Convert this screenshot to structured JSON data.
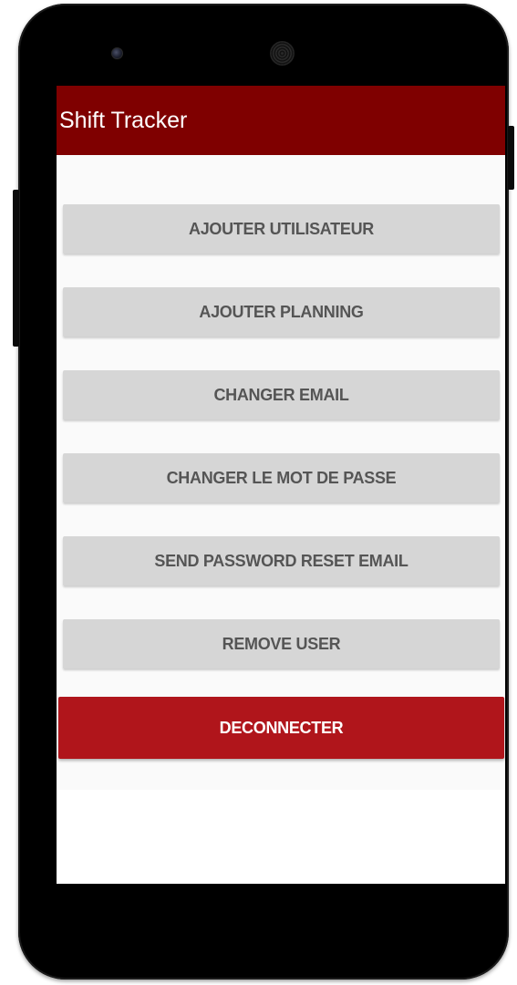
{
  "app": {
    "title": "Shift Tracker"
  },
  "menu": {
    "buttons": [
      "AJOUTER UTILISATEUR",
      "AJOUTER PLANNING",
      "CHANGER EMAIL",
      "CHANGER LE MOT DE PASSE",
      "SEND PASSWORD RESET EMAIL",
      "REMOVE USER"
    ],
    "logout_label": "DECONNECTER"
  },
  "colors": {
    "app_bar": "#7f0000",
    "logout_button": "#b0151b",
    "secondary_button": "#d6d6d6",
    "secondary_button_text": "#555555"
  },
  "icons": {
    "camera": "front-camera-icon",
    "speaker": "earpiece-speaker-icon"
  }
}
